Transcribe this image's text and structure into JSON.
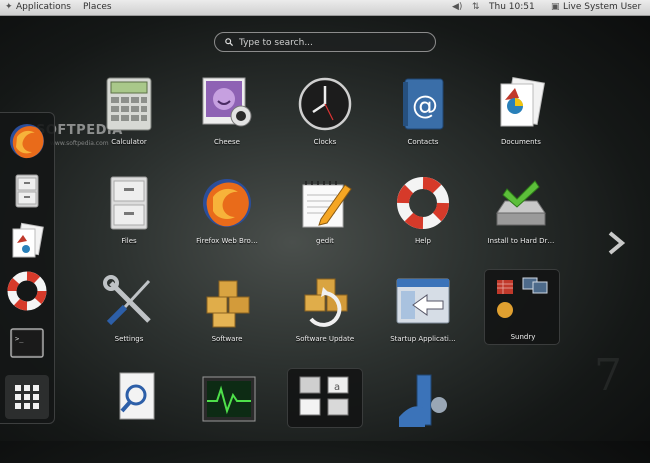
{
  "topbar": {
    "applications": "Applications",
    "places": "Places",
    "clock": "Thu 10:51",
    "user": "Live System User",
    "icons": [
      "volume-icon",
      "network-icon",
      "user-status-icon"
    ]
  },
  "search": {
    "placeholder": "Type to search..."
  },
  "watermark": {
    "logo": "SOFTPEDIA",
    "url": "www.softpedia.com",
    "mark": "7"
  },
  "dash": {
    "items": [
      "firefox",
      "files",
      "documents",
      "help",
      "terminal",
      "show-applications"
    ]
  },
  "apps": [
    {
      "label": "Calculator",
      "icon": "calculator-icon"
    },
    {
      "label": "Cheese",
      "icon": "cheese-icon"
    },
    {
      "label": "Clocks",
      "icon": "clock-icon"
    },
    {
      "label": "Contacts",
      "icon": "contacts-icon"
    },
    {
      "label": "Documents",
      "icon": "documents-icon"
    },
    {
      "label": "Files",
      "icon": "files-icon"
    },
    {
      "label": "Firefox Web Bro…",
      "icon": "firefox-icon"
    },
    {
      "label": "gedit",
      "icon": "gedit-icon"
    },
    {
      "label": "Help",
      "icon": "help-lifebuoy-icon"
    },
    {
      "label": "Install to Hard Dr…",
      "icon": "install-drive-icon"
    },
    {
      "label": "Settings",
      "icon": "settings-tools-icon"
    },
    {
      "label": "Software",
      "icon": "software-boxes-icon"
    },
    {
      "label": "Software Update",
      "icon": "software-update-icon"
    },
    {
      "label": "Startup Applicati…",
      "icon": "startup-applications-icon"
    },
    {
      "label": "Sundry",
      "icon": "sundry-folder-icon"
    }
  ],
  "next_page_icon": "chevron-right-icon"
}
